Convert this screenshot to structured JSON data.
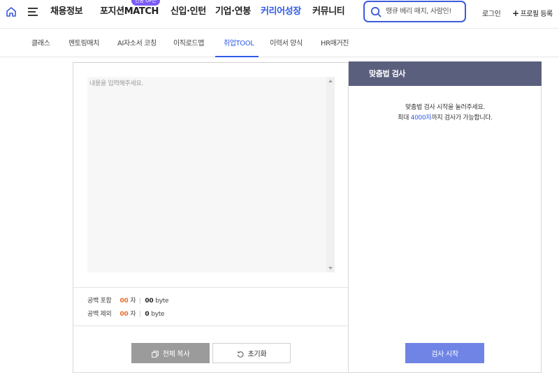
{
  "header": {
    "nav": [
      {
        "label": "채용정보"
      },
      {
        "label": "포지션",
        "label_strong": "MATCH",
        "badge": "연봉 UP은"
      },
      {
        "label": "신입·인턴"
      },
      {
        "label": "기업·연봉"
      },
      {
        "label": "커리어성장"
      },
      {
        "label": "커뮤니티"
      }
    ],
    "search_placeholder": "땡큐 베리 매치, 사람인!",
    "login": "로그인",
    "profile_plus": "+",
    "profile": "프로필 등록"
  },
  "subnav": {
    "tabs": [
      {
        "label": "클래스"
      },
      {
        "label": "멘토링매치"
      },
      {
        "label": "AI자소서 코칭"
      },
      {
        "label": "이직로드맵"
      },
      {
        "label": "취업TOOL"
      },
      {
        "label": "이력서 양식"
      },
      {
        "label": "HR매거진"
      }
    ],
    "active_index": 4
  },
  "editor": {
    "placeholder": "내용을 입력해주세요.",
    "with_space_label": "공백 포함",
    "without_space_label": "공백 제외",
    "with_space_chars": "00",
    "without_space_chars": "00",
    "char_unit": "자",
    "with_space_bytes": "00",
    "without_space_bytes": "0",
    "byte_unit": "byte",
    "copy_button": "전체 복사",
    "reset_button": "초기화"
  },
  "spellcheck": {
    "title": "맞춤법 검사",
    "guide_line1": "맞춤법 검사 시작을 눌러주세요.",
    "guide_prefix": "최대 ",
    "guide_highlight": "4000자",
    "guide_suffix": "까지 검사가 가능합니다.",
    "check_button": "검사 시작"
  },
  "colors": {
    "accent": "#2f5bea",
    "panel_header": "#5b5f7e",
    "count": "#e6702f",
    "check_button": "#6f84e5",
    "copy_button": "#9b9b9b",
    "badge": "#7b5cf5"
  }
}
